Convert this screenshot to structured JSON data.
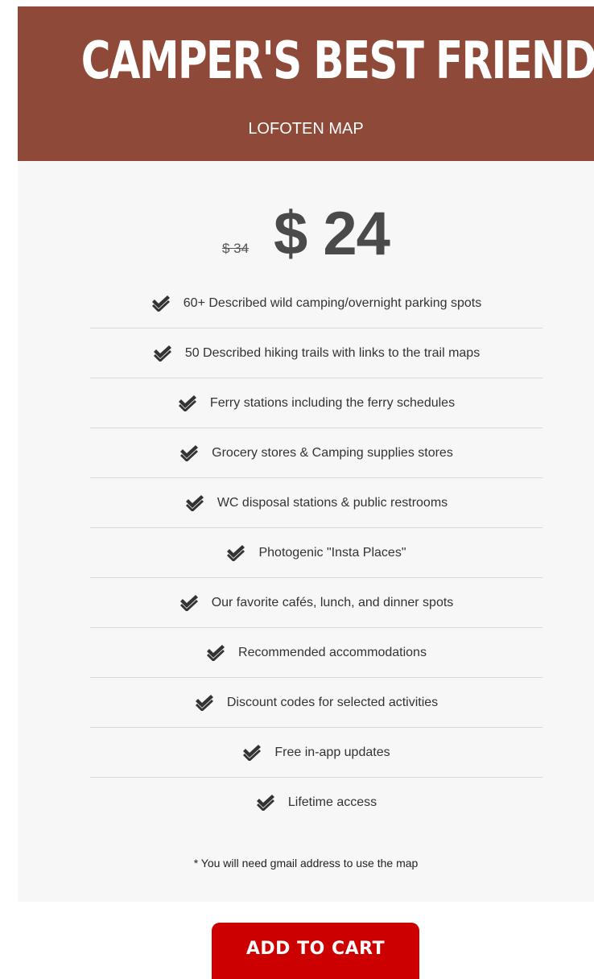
{
  "header": {
    "title": "CAMPER'S BEST FRIEND",
    "subtitle": "LOFOTEN MAP",
    "background_color": "#8e4938"
  },
  "pricing": {
    "old_price": "$ 34",
    "new_price": "$ 24"
  },
  "features": [
    {
      "icon": "double-check-icon",
      "text": "60+ Described wild camping/overnight parking spots"
    },
    {
      "icon": "double-check-icon",
      "text": "50 Described hiking trails with links to the trail maps"
    },
    {
      "icon": "double-check-icon",
      "text": "Ferry stations including the ferry schedules"
    },
    {
      "icon": "double-check-icon",
      "text": "Grocery stores & Camping supplies stores"
    },
    {
      "icon": "double-check-icon",
      "text": "WC disposal stations & public restrooms"
    },
    {
      "icon": "double-check-icon",
      "text": "Photogenic \"Insta Places\""
    },
    {
      "icon": "double-check-icon",
      "text": "Our favorite cafés, lunch, and dinner spots"
    },
    {
      "icon": "double-check-icon",
      "text": "Recommended accommodations"
    },
    {
      "icon": "double-check-icon",
      "text": "Discount codes for selected activities"
    },
    {
      "icon": "double-check-icon",
      "text": "Free in-app updates"
    },
    {
      "icon": "double-check-icon",
      "text": "Lifetime access"
    }
  ],
  "note": "* You will need gmail address to use the map",
  "cta": {
    "label": "ADD TO CART",
    "color": "#cc0000"
  }
}
